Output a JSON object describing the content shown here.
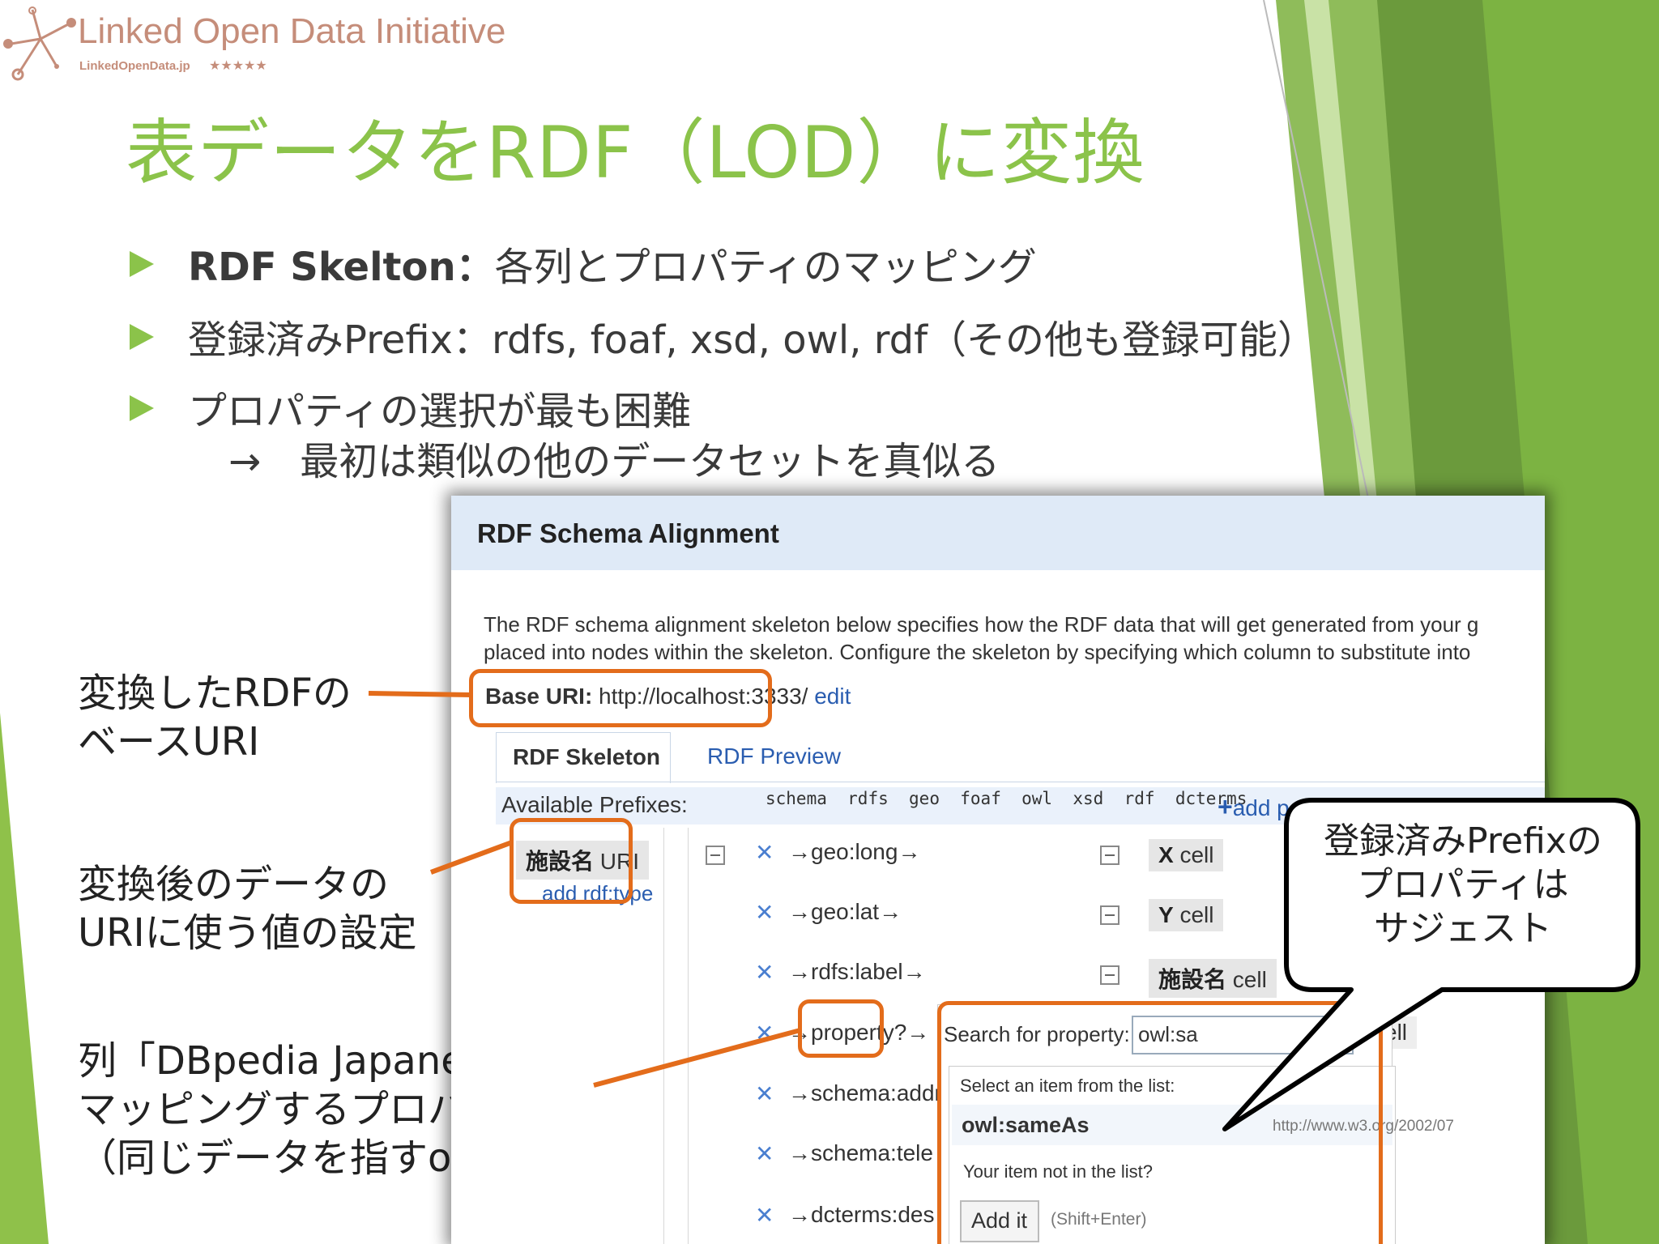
{
  "logo": {
    "title": "Linked Open Data Initiative",
    "subtitle": "LinkedOpenData.jp",
    "stars": "★★★★★"
  },
  "slide": {
    "title": "表データをRDF（LOD）に変換",
    "bullets": [
      {
        "bold": "RDF Skelton：",
        "text": "各列とプロパティのマッピング"
      },
      {
        "bold": "",
        "text": "登録済みPrefix：rdfs, foaf, xsd, owl, rdf（その他も登録可能）"
      },
      {
        "bold": "",
        "text": "プロパティの選択が最も困難"
      }
    ],
    "sub_bullet": "→　最初は類似の他のデータセットを真似る"
  },
  "notes": {
    "base_uri_note": [
      "変換したRDFの",
      "ベースURI"
    ],
    "uri_value_note": [
      "変換後のデータの",
      "URIに使う値の設定"
    ],
    "property_note": [
      "列「DBpedia Japanese」に",
      "マッピングするプロパティ",
      "（同じデータを指すowl:sameAs）"
    ]
  },
  "callout": {
    "lines": [
      "登録済みPrefixの",
      "プロパティは",
      "サジェスト"
    ]
  },
  "dialog": {
    "title": "RDF Schema Alignment",
    "description_line1": "The RDF schema alignment skeleton below specifies how the RDF data that will get generated from your g",
    "description_line2": "placed into nodes within the skeleton. Configure the skeleton by specifying which column to substitute into",
    "base_uri_label": "Base URI:",
    "base_uri_value": "http://localhost:3333/",
    "base_uri_edit": "edit",
    "tabs": {
      "skeleton": "RDF Skeleton",
      "preview": "RDF Preview"
    },
    "prefixes_label": "Available Prefixes:",
    "prefixes": [
      "schema",
      "rdfs",
      "geo",
      "foaf",
      "owl",
      "xsd",
      "rdf",
      "dcterms"
    ],
    "add_prefix": "add p",
    "subject": {
      "name": "施設名",
      "suffix": "URI",
      "add_type": "add rdf:type"
    },
    "properties": [
      {
        "label": "geo:long",
        "target_bold": "X",
        "target": "cell"
      },
      {
        "label": "geo:lat",
        "target_bold": "Y",
        "target": "cell"
      },
      {
        "label": "rdfs:label",
        "target_bold": "施設名",
        "target": "cell"
      },
      {
        "label": "property?",
        "target_bold": "",
        "target": "ell"
      },
      {
        "label": "schema:addr",
        "target_bold": "",
        "target": ""
      },
      {
        "label": "schema:tele",
        "target_bold": "",
        "target": ""
      },
      {
        "label": "dcterms:des",
        "target_bold": "",
        "target": ""
      }
    ],
    "search": {
      "label": "Search for property:",
      "value": "owl:sa",
      "select_hint": "Select an item from the list:",
      "suggestion": "owl:sameAs",
      "suggestion_uri": "http://www.w3.org/2002/07",
      "not_in_list": "Your item not in the list?",
      "add_button": "Add it",
      "shortcut": "(Shift+Enter)"
    }
  },
  "colors": {
    "accent_green": "#8bc34a",
    "highlight_orange": "#e36c1b",
    "link_blue": "#2a5db0",
    "header_blue": "#dfeaf7"
  }
}
